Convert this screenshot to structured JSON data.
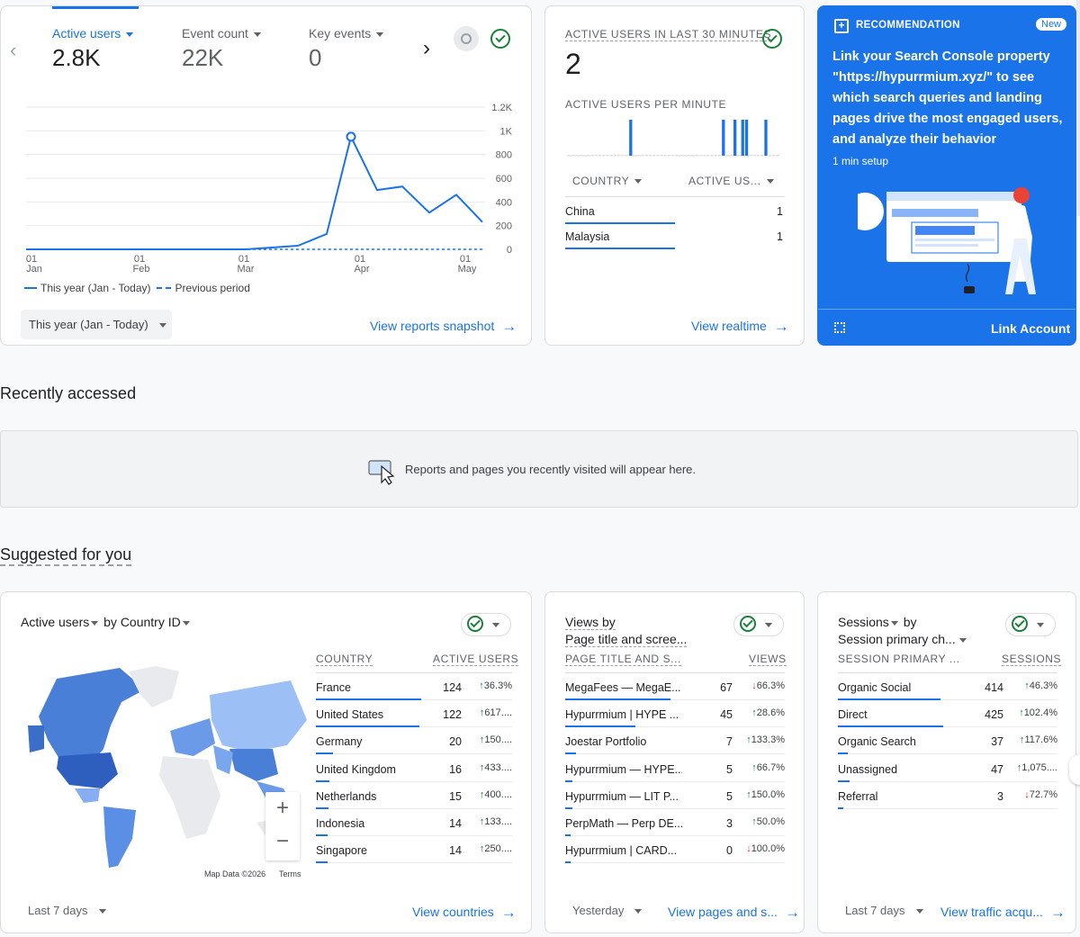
{
  "overview": {
    "metrics": [
      {
        "label": "Active users",
        "value": "2.8K"
      },
      {
        "label": "Event count",
        "value": "22K"
      },
      {
        "label": "Key events",
        "value": "0"
      }
    ],
    "y_ticks": [
      "1.2K",
      "1K",
      "800",
      "600",
      "400",
      "200",
      "0"
    ],
    "x_ticks": [
      [
        "01",
        "Jan"
      ],
      [
        "01",
        "Feb"
      ],
      [
        "01",
        "Mar"
      ],
      [
        "01",
        "Apr"
      ],
      [
        "01",
        "May"
      ]
    ],
    "legend_this": "This year (Jan - Today)",
    "legend_prev": "Previous period",
    "date_range": "This year (Jan - Today)",
    "view_link": "View reports snapshot"
  },
  "chart_data": {
    "type": "line",
    "x": [
      "01 Jan",
      "01 Feb",
      "01 Mar",
      "15 Mar",
      "25 Mar",
      "01 Apr",
      "08 Apr",
      "15 Apr",
      "22 Apr",
      "01 May",
      "08 May"
    ],
    "series": [
      {
        "name": "This year (Jan - Today)",
        "values": [
          0,
          0,
          0,
          30,
          130,
          950,
          500,
          530,
          310,
          460,
          230
        ]
      },
      {
        "name": "Previous period",
        "values": [
          0,
          0,
          0,
          0,
          0,
          0,
          0,
          0,
          0,
          0,
          0
        ]
      }
    ],
    "ylim": [
      0,
      1200
    ],
    "xlabel": "",
    "ylabel": ""
  },
  "realtime": {
    "title": "ACTIVE USERS IN LAST 30 MINUTES",
    "value": "2",
    "per_minute_title": "ACTIVE USERS PER MINUTE",
    "per_minute_bars": [
      0,
      0,
      0,
      0,
      0,
      0,
      0,
      0,
      0,
      0,
      0,
      0,
      0,
      0,
      0,
      0,
      1,
      0,
      0,
      0,
      0,
      0,
      0,
      0,
      0,
      0,
      0,
      0,
      0,
      0,
      0,
      0,
      0,
      0,
      0,
      0,
      0,
      0,
      0,
      0,
      1,
      0,
      0,
      1,
      0,
      1,
      1,
      0,
      0,
      0,
      0,
      1,
      0,
      0,
      0
    ],
    "col_country": "COUNTRY",
    "col_users": "ACTIVE US...",
    "rows": [
      {
        "name": "China",
        "value": "1"
      },
      {
        "name": "Malaysia",
        "value": "1"
      }
    ],
    "view_link": "View realtime"
  },
  "recommendation": {
    "label": "RECOMMENDATION",
    "badge": "New",
    "text": "Link your Search Console property \"https://hypurrmium.xyz/\" to see which search queries and landing pages drive the most engaged users, and analyze their behavior",
    "setup": "1 min setup",
    "action": "Link Account",
    "colors": {
      "bg": "#1a73e8"
    }
  },
  "recent": {
    "heading": "Recently accessed",
    "empty_text": "Reports and pages you recently visited will appear here."
  },
  "suggested": {
    "heading": "Suggested for you",
    "country_card": {
      "title_a": "Active users",
      "title_b": "by Country ID",
      "col_1": "COUNTRY",
      "col_2": "ACTIVE USERS",
      "rows": [
        {
          "name": "France",
          "value": "124",
          "change": "36.3%",
          "dir": "up",
          "bar": 1.0
        },
        {
          "name": "United States",
          "value": "122",
          "change": "617....",
          "dir": "up",
          "bar": 0.98
        },
        {
          "name": "Germany",
          "value": "20",
          "change": "150....",
          "dir": "up",
          "bar": 0.16
        },
        {
          "name": "United Kingdom",
          "value": "16",
          "change": "433....",
          "dir": "up",
          "bar": 0.13
        },
        {
          "name": "Netherlands",
          "value": "15",
          "change": "400....",
          "dir": "up",
          "bar": 0.12
        },
        {
          "name": "Indonesia",
          "value": "14",
          "change": "133....",
          "dir": "up",
          "bar": 0.11
        },
        {
          "name": "Singapore",
          "value": "14",
          "change": "250....",
          "dir": "up",
          "bar": 0.11
        }
      ],
      "map_credit": "Map Data ©2026",
      "map_terms": "Terms",
      "zoom_in": "+",
      "zoom_out": "−",
      "range": "Last 7 days",
      "view_link": "View countries"
    },
    "pages_card": {
      "title_a": "Views by",
      "title_b": "Page title and scree...",
      "col_1": "PAGE TITLE AND S...",
      "col_2": "VIEWS",
      "rows": [
        {
          "name": "MegaFees — MegaE...",
          "value": "67",
          "change": "66.3%",
          "dir": "down",
          "bar": 1.0
        },
        {
          "name": "Hypurrmium | HYPE ...",
          "value": "45",
          "change": "28.6%",
          "dir": "up",
          "bar": 0.67
        },
        {
          "name": "Joestar Portfolio",
          "value": "7",
          "change": "133.3%",
          "dir": "up",
          "bar": 0.1
        },
        {
          "name": "Hypurrmium — HYPE...",
          "value": "5",
          "change": "66.7%",
          "dir": "up",
          "bar": 0.07
        },
        {
          "name": "Hypurrmium — LIT P...",
          "value": "5",
          "change": "150.0%",
          "dir": "up",
          "bar": 0.07
        },
        {
          "name": "PerpMath — Perp DE...",
          "value": "3",
          "change": "50.0%",
          "dir": "up",
          "bar": 0.04
        },
        {
          "name": "Hypurrmium | CARD...",
          "value": "0",
          "change": "100.0%",
          "dir": "down",
          "bar": 0.0
        }
      ],
      "range": "Yesterday",
      "view_link": "View pages and s..."
    },
    "sessions_card": {
      "title_a": "Sessions",
      "title_b": "by",
      "title_c": "Session primary ch...",
      "col_1": "SESSION PRIMARY ...",
      "col_2": "SESSIONS",
      "rows": [
        {
          "name": "Organic Social",
          "value": "414",
          "change": "46.3%",
          "dir": "up",
          "bar": 0.97
        },
        {
          "name": "Direct",
          "value": "425",
          "change": "102.4%",
          "dir": "up",
          "bar": 1.0
        },
        {
          "name": "Organic Search",
          "value": "37",
          "change": "117.6%",
          "dir": "up",
          "bar": 0.09
        },
        {
          "name": "Unassigned",
          "value": "47",
          "change": "1,075....",
          "dir": "up",
          "bar": 0.11
        },
        {
          "name": "Referral",
          "value": "3",
          "change": "72.7%",
          "dir": "down",
          "bar": 0.01
        }
      ],
      "range": "Last 7 days",
      "view_link": "View traffic acqu..."
    }
  }
}
